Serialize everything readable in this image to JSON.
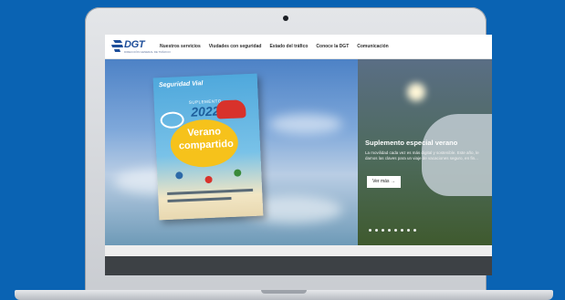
{
  "nav": {
    "logo_text": "DGT",
    "logo_subtext": "DIRECCIÓN GENERAL DE TRÁFICO",
    "items": [
      {
        "label": "Nuestros servicios"
      },
      {
        "label": "Viudades con seguridad"
      },
      {
        "label": "Estado del tráfico"
      },
      {
        "label": "Conoce la DGT"
      },
      {
        "label": "Comunicación"
      }
    ]
  },
  "hero": {
    "magazine": {
      "brand": "Seguridad Vial",
      "supplement": "SUPLEMENTO",
      "year": "2022",
      "title_line1": "Verano",
      "title_line2": "compartido"
    },
    "panel": {
      "title": "Suplemento especial verano",
      "text": "La movilidad cada vez es más digital y sostenible. Este año, le damos las claves para un viaje de vacaciones seguro, en fin...",
      "button_label": "Ver más →",
      "slide_count": 8
    }
  },
  "colors": {
    "background": "#0a63b3",
    "brand": "#1f4f9a"
  }
}
